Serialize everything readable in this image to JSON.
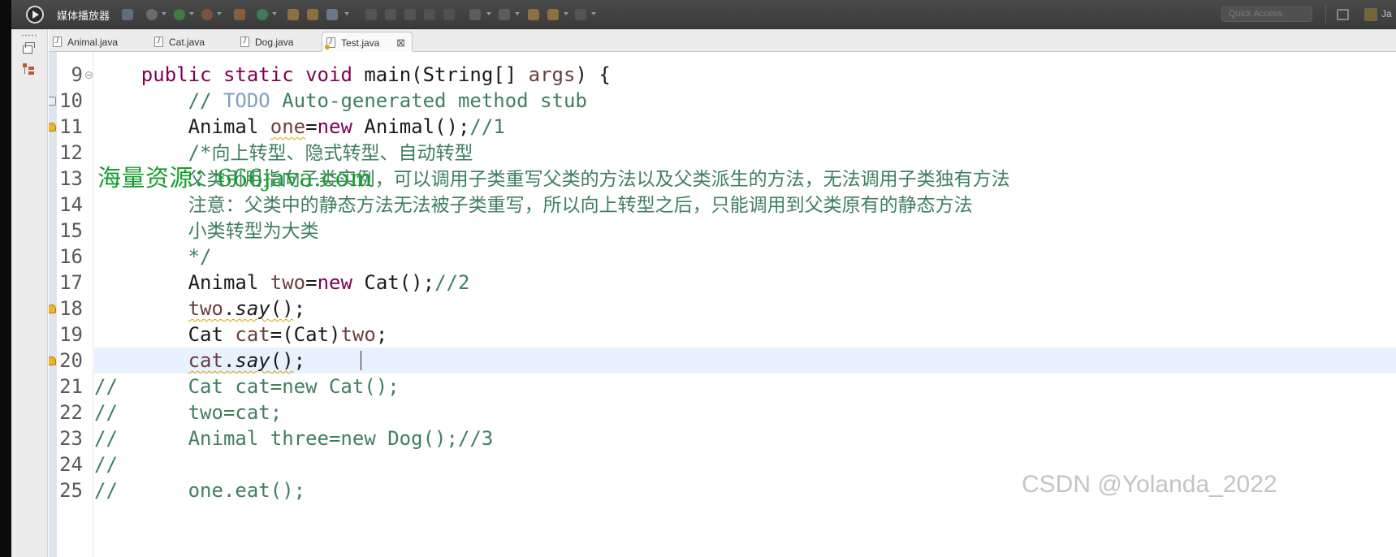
{
  "app": {
    "title": "媒体播放器"
  },
  "toolbar": {
    "quick_access_placeholder": "Quick Access",
    "perspective_label": "Ja"
  },
  "tabs": [
    {
      "label": "Animal.java",
      "active": false
    },
    {
      "label": "Cat.java",
      "active": false
    },
    {
      "label": "Dog.java",
      "active": false
    },
    {
      "label": "Test.java",
      "active": true
    }
  ],
  "editor": {
    "lines": [
      {
        "num": "9",
        "marker": "fold",
        "tokens": [
          {
            "t": "    "
          },
          {
            "t": "public",
            "c": "kw"
          },
          {
            "t": " "
          },
          {
            "t": "static",
            "c": "kw"
          },
          {
            "t": " "
          },
          {
            "t": "void",
            "c": "kw"
          },
          {
            "t": " main(String[] "
          },
          {
            "t": "args",
            "c": "var"
          },
          {
            "t": ") {"
          }
        ]
      },
      {
        "num": "10",
        "marker": "task",
        "tokens": [
          {
            "t": "        "
          },
          {
            "t": "// ",
            "c": "cm"
          },
          {
            "t": "TODO",
            "c": "todo"
          },
          {
            "t": " Auto-generated method stub",
            "c": "cm"
          }
        ]
      },
      {
        "num": "11",
        "marker": "warning",
        "tokens": [
          {
            "t": "        Animal "
          },
          {
            "t": "one",
            "c": "var warn"
          },
          {
            "t": "="
          },
          {
            "t": "new",
            "c": "kw"
          },
          {
            "t": " Animal();"
          },
          {
            "t": "//1",
            "c": "cm"
          }
        ]
      },
      {
        "num": "12",
        "marker": "",
        "tokens": [
          {
            "t": "        "
          },
          {
            "t": "/*",
            "c": "cm"
          },
          {
            "t": "向上转型、隐式转型、自动转型",
            "c": "cm cn"
          }
        ]
      },
      {
        "num": "13",
        "marker": "",
        "tokens": [
          {
            "t": "        "
          },
          {
            "t": "父类引用指向子类实例，可以调用子类重写父类的方法以及父类派生的方法，无法调用子类独有方法",
            "c": "cm cn"
          }
        ]
      },
      {
        "num": "14",
        "marker": "",
        "tokens": [
          {
            "t": "        "
          },
          {
            "t": "注意：父类中的静态方法无法被子类重写，所以向上转型之后，只能调用到父类原有的静态方法",
            "c": "cm cn"
          }
        ]
      },
      {
        "num": "15",
        "marker": "",
        "tokens": [
          {
            "t": "        "
          },
          {
            "t": "小类转型为大类",
            "c": "cm cn"
          }
        ]
      },
      {
        "num": "16",
        "marker": "",
        "tokens": [
          {
            "t": "        "
          },
          {
            "t": "*/",
            "c": "cm"
          }
        ]
      },
      {
        "num": "17",
        "marker": "",
        "tokens": [
          {
            "t": "        Animal "
          },
          {
            "t": "two",
            "c": "var"
          },
          {
            "t": "="
          },
          {
            "t": "new",
            "c": "kw"
          },
          {
            "t": " Cat();"
          },
          {
            "t": "//2",
            "c": "cm"
          }
        ]
      },
      {
        "num": "18",
        "marker": "warning",
        "tokens": [
          {
            "t": "        "
          },
          {
            "t": "two",
            "c": "var warn"
          },
          {
            "t": ".",
            "c": "warn"
          },
          {
            "t": "say",
            "c": "meth warn"
          },
          {
            "t": "()",
            "c": "warn"
          },
          {
            "t": ";"
          }
        ]
      },
      {
        "num": "19",
        "marker": "",
        "tokens": [
          {
            "t": "        Cat "
          },
          {
            "t": "cat",
            "c": "var"
          },
          {
            "t": "=(Cat)"
          },
          {
            "t": "two",
            "c": "var"
          },
          {
            "t": ";"
          }
        ]
      },
      {
        "num": "20",
        "marker": "warning",
        "current": true,
        "tokens": [
          {
            "t": "        "
          },
          {
            "t": "cat",
            "c": "var warn"
          },
          {
            "t": ".",
            "c": "warn"
          },
          {
            "t": "say",
            "c": "meth warn"
          },
          {
            "t": "()",
            "c": "warn"
          },
          {
            "t": ";"
          }
        ]
      },
      {
        "num": "21",
        "marker": "",
        "tokens": [
          {
            "t": "//      Cat cat=new Cat();",
            "c": "cm"
          }
        ]
      },
      {
        "num": "22",
        "marker": "",
        "tokens": [
          {
            "t": "//      two=cat;",
            "c": "cm"
          }
        ]
      },
      {
        "num": "23",
        "marker": "",
        "tokens": [
          {
            "t": "//      Animal three=new Dog();//3",
            "c": "cm"
          }
        ]
      },
      {
        "num": "24",
        "marker": "",
        "tokens": [
          {
            "t": "//",
            "c": "cm"
          }
        ]
      },
      {
        "num": "25",
        "marker": "",
        "tokens": [
          {
            "t": "//      one.eat();",
            "c": "cm"
          }
        ]
      }
    ]
  },
  "overlays": {
    "watermark": "海量资源：666java.com",
    "csdn": "CSDN @Yolanda_2022"
  },
  "colors": {
    "keyword": "#7f0055",
    "comment": "#3f7f5f",
    "todo": "#7f9fbf",
    "variable": "#6a3e3e",
    "current_line": "#e8f2fe",
    "watermark": "#149d2e"
  }
}
